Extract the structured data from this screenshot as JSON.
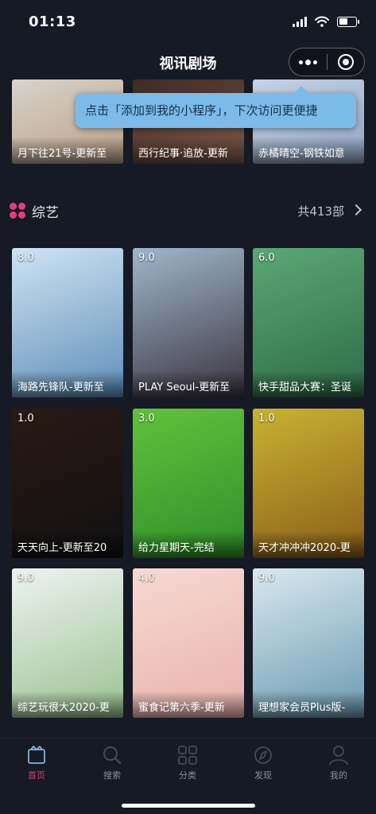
{
  "status_bar": {
    "time": "01:13",
    "battery_level": 0.55
  },
  "nav_bar": {
    "title": "视讯剧场"
  },
  "tooltip": {
    "text": "点击「添加到我的小程序」，下次访问更便捷"
  },
  "top_row": [
    {
      "caption": "月下往21号-更新至",
      "colors": [
        "#d8d4c9",
        "#b9a08a"
      ]
    },
    {
      "caption": "西行纪事·追放-更新",
      "colors": [
        "#3e2a25",
        "#7e5a4a"
      ]
    },
    {
      "caption": "赤橘晴空-钢铁如意",
      "colors": [
        "#c7d3e4",
        "#8fa3c0"
      ]
    }
  ],
  "section": {
    "title": "综艺",
    "count": "共413部"
  },
  "grid": [
    {
      "score": "8.0",
      "caption": "海路先锋队-更新至",
      "colors": [
        "#cfe3f2",
        "#5f8fb9"
      ]
    },
    {
      "score": "9.0",
      "caption": "PLAY Seoul-更新至",
      "colors": [
        "#9fb7c9",
        "#3c3440"
      ]
    },
    {
      "score": "6.0",
      "caption": "快手甜品大赛：圣诞",
      "colors": [
        "#5aa873",
        "#2f6b48"
      ]
    },
    {
      "score": "1.0",
      "caption": "天天向上-更新至20",
      "colors": [
        "#2a1a14",
        "#101012"
      ]
    },
    {
      "score": "3.0",
      "caption": "给力星期天-完结",
      "colors": [
        "#5fc23b",
        "#2f8f2a"
      ]
    },
    {
      "score": "1.0",
      "caption": "天才冲冲冲2020-更",
      "colors": [
        "#c9b232",
        "#8a5f1a"
      ]
    },
    {
      "score": "9.0",
      "caption": "综艺玩很大2020-更",
      "colors": [
        "#eef2f2",
        "#9ac28f"
      ]
    },
    {
      "score": "4.0",
      "caption": "蜜食记第六季-更新",
      "colors": [
        "#f7d8d3",
        "#e9b3ad"
      ]
    },
    {
      "score": "9.0",
      "caption": "理想家会员Plus版-",
      "colors": [
        "#d8e8ee",
        "#6b9bb2"
      ]
    }
  ],
  "tabs": [
    {
      "label": "首页",
      "icon": "home-icon"
    },
    {
      "label": "搜索",
      "icon": "search-icon"
    },
    {
      "label": "分类",
      "icon": "category-icon"
    },
    {
      "label": "发现",
      "icon": "discover-icon"
    },
    {
      "label": "我的",
      "icon": "profile-icon"
    }
  ],
  "colors": {
    "accent": "#e23a78",
    "background": "#161a24",
    "tooltip": "#7cbbe9"
  }
}
